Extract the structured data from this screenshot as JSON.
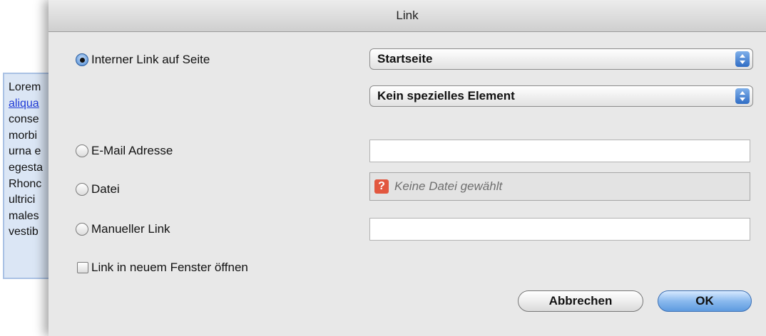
{
  "background_doc": {
    "lines": [
      {
        "text": "Lorem",
        "link": false
      },
      {
        "text": "aliqua",
        "link": true
      },
      {
        "text": "conse",
        "link": false
      },
      {
        "text": "morbi",
        "link": false
      },
      {
        "text": "urna e",
        "link": false
      },
      {
        "text": "egesta",
        "link": false
      },
      {
        "text": "Rhonc",
        "link": false
      },
      {
        "text": "ultrici",
        "link": false
      },
      {
        "text": "males",
        "link": false
      },
      {
        "text": "vestib",
        "link": false
      }
    ]
  },
  "dialog": {
    "title": "Link",
    "options": {
      "internal_label": "Interner Link auf Seite",
      "email_label": "E-Mail Adresse",
      "file_label": "Datei",
      "manual_label": "Manueller Link"
    },
    "selected_option": "internal",
    "page_select": {
      "value": "Startseite"
    },
    "element_select": {
      "value": "Kein spezielles Element"
    },
    "email_input": {
      "value": ""
    },
    "file_input": {
      "placeholder": "Keine Datei gewählt"
    },
    "manual_input": {
      "value": ""
    },
    "new_window_checkbox": {
      "label": "Link in neuem Fenster öffnen",
      "checked": false
    },
    "buttons": {
      "cancel": "Abbrechen",
      "ok": "OK"
    }
  }
}
